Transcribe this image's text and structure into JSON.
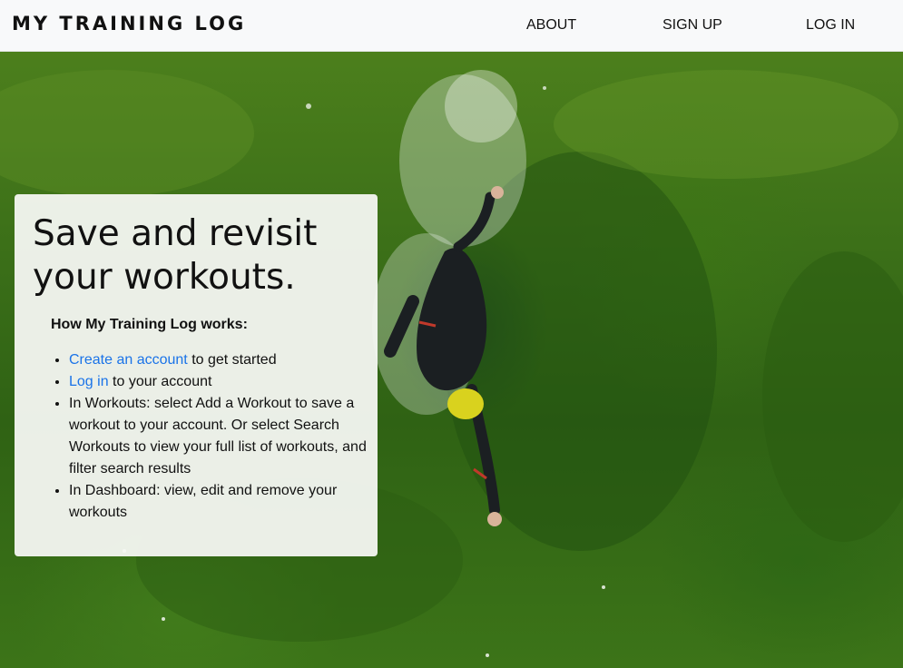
{
  "navbar": {
    "brand": "MY TRAINING LOG",
    "links": {
      "about": "ABOUT",
      "signup": "SIGN UP",
      "login": "LOG IN"
    }
  },
  "hero": {
    "background_image": "aerial-swimmer-in-green-water",
    "card": {
      "title": "Save and revisit your workouts.",
      "subtitle": "How My Training Log works:",
      "steps": [
        {
          "link": "Create an account",
          "text": " to get started"
        },
        {
          "link": "Log in",
          "text": " to your account"
        },
        {
          "text": "In Workouts: select Add a Workout to save a workout to your account. Or select Search Workouts to view your full list of workouts, and filter search results"
        },
        {
          "text": "In Dashboard: view, edit and remove your workouts"
        }
      ]
    }
  },
  "colors": {
    "navbar_bg": "#f8f9fa",
    "link": "#1a73e8",
    "text": "#111111",
    "water": "#3a6e18"
  }
}
